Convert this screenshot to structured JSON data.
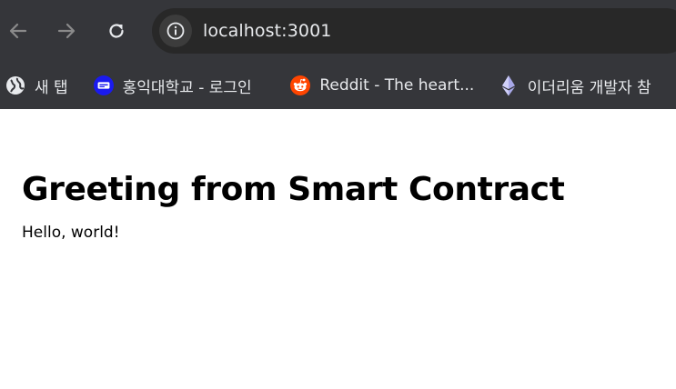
{
  "browser": {
    "url": "localhost:3001",
    "colors": {
      "frame": "#35363a",
      "omnibox": "#282828",
      "text": "#e8eaed",
      "icon_dim": "#8a8a8a"
    },
    "bookmarks": [
      {
        "label": "새 탭",
        "icon": "globe-icon"
      },
      {
        "label": "홍익대학교 - 로그인",
        "icon": "hongik-icon"
      },
      {
        "label": "Reddit - The heart...",
        "icon": "reddit-icon"
      },
      {
        "label": "이더리움 개발자 참",
        "icon": "ethereum-icon"
      }
    ]
  },
  "page": {
    "heading": "Greeting from Smart Contract",
    "message": "Hello, world!"
  }
}
